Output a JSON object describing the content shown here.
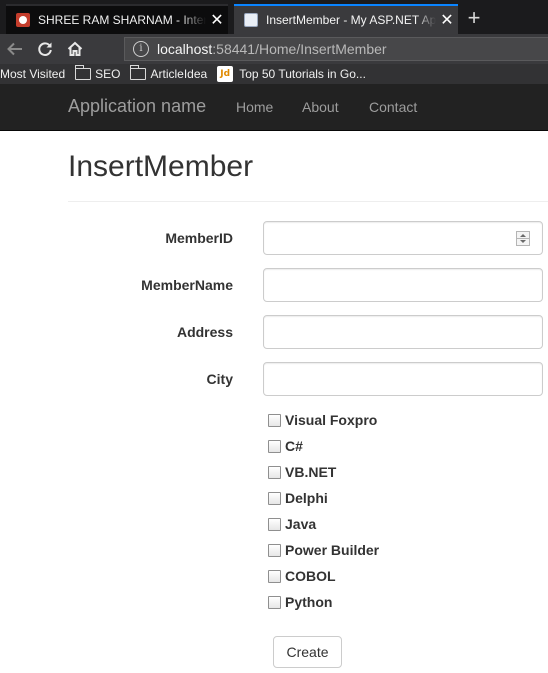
{
  "browser": {
    "tabs": [
      {
        "title": "SHREE RAM SHARNAM - Interr",
        "close": "✕"
      },
      {
        "title": "InsertMember - My ASP.NET Ap",
        "close": "✕"
      }
    ],
    "new_tab": "+",
    "url_host": "localhost",
    "url_rest": ":58441/Home/InsertMember",
    "bookmarks": [
      "Most Visited",
      "SEO",
      "ArticleIdea",
      "Top 50 Tutorials in Go..."
    ],
    "bookmark_badge": "Jd"
  },
  "app": {
    "brand": "Application name",
    "nav": [
      "Home",
      "About",
      "Contact"
    ]
  },
  "page": {
    "title": "InsertMember",
    "fields": [
      {
        "label": "MemberID",
        "value": ""
      },
      {
        "label": "MemberName",
        "value": ""
      },
      {
        "label": "Address",
        "value": ""
      },
      {
        "label": "City",
        "value": ""
      }
    ],
    "languages": [
      "Visual Foxpro",
      "C#",
      "VB.NET",
      "Delphi",
      "Java",
      "Power Builder",
      "COBOL",
      "Python"
    ],
    "submit_label": "Create"
  }
}
